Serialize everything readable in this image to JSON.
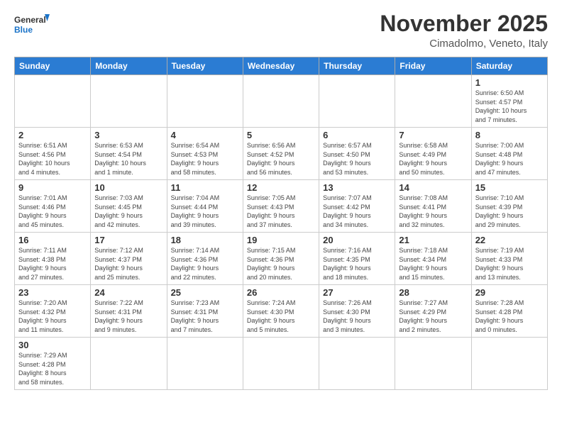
{
  "header": {
    "logo_general": "General",
    "logo_blue": "Blue",
    "title": "November 2025",
    "subtitle": "Cimadolmo, Veneto, Italy"
  },
  "weekdays": [
    "Sunday",
    "Monday",
    "Tuesday",
    "Wednesday",
    "Thursday",
    "Friday",
    "Saturday"
  ],
  "weeks": [
    [
      {
        "day": "",
        "info": ""
      },
      {
        "day": "",
        "info": ""
      },
      {
        "day": "",
        "info": ""
      },
      {
        "day": "",
        "info": ""
      },
      {
        "day": "",
        "info": ""
      },
      {
        "day": "",
        "info": ""
      },
      {
        "day": "1",
        "info": "Sunrise: 6:50 AM\nSunset: 4:57 PM\nDaylight: 10 hours\nand 7 minutes."
      }
    ],
    [
      {
        "day": "2",
        "info": "Sunrise: 6:51 AM\nSunset: 4:56 PM\nDaylight: 10 hours\nand 4 minutes."
      },
      {
        "day": "3",
        "info": "Sunrise: 6:53 AM\nSunset: 4:54 PM\nDaylight: 10 hours\nand 1 minute."
      },
      {
        "day": "4",
        "info": "Sunrise: 6:54 AM\nSunset: 4:53 PM\nDaylight: 9 hours\nand 58 minutes."
      },
      {
        "day": "5",
        "info": "Sunrise: 6:56 AM\nSunset: 4:52 PM\nDaylight: 9 hours\nand 56 minutes."
      },
      {
        "day": "6",
        "info": "Sunrise: 6:57 AM\nSunset: 4:50 PM\nDaylight: 9 hours\nand 53 minutes."
      },
      {
        "day": "7",
        "info": "Sunrise: 6:58 AM\nSunset: 4:49 PM\nDaylight: 9 hours\nand 50 minutes."
      },
      {
        "day": "8",
        "info": "Sunrise: 7:00 AM\nSunset: 4:48 PM\nDaylight: 9 hours\nand 47 minutes."
      }
    ],
    [
      {
        "day": "9",
        "info": "Sunrise: 7:01 AM\nSunset: 4:46 PM\nDaylight: 9 hours\nand 45 minutes."
      },
      {
        "day": "10",
        "info": "Sunrise: 7:03 AM\nSunset: 4:45 PM\nDaylight: 9 hours\nand 42 minutes."
      },
      {
        "day": "11",
        "info": "Sunrise: 7:04 AM\nSunset: 4:44 PM\nDaylight: 9 hours\nand 39 minutes."
      },
      {
        "day": "12",
        "info": "Sunrise: 7:05 AM\nSunset: 4:43 PM\nDaylight: 9 hours\nand 37 minutes."
      },
      {
        "day": "13",
        "info": "Sunrise: 7:07 AM\nSunset: 4:42 PM\nDaylight: 9 hours\nand 34 minutes."
      },
      {
        "day": "14",
        "info": "Sunrise: 7:08 AM\nSunset: 4:41 PM\nDaylight: 9 hours\nand 32 minutes."
      },
      {
        "day": "15",
        "info": "Sunrise: 7:10 AM\nSunset: 4:39 PM\nDaylight: 9 hours\nand 29 minutes."
      }
    ],
    [
      {
        "day": "16",
        "info": "Sunrise: 7:11 AM\nSunset: 4:38 PM\nDaylight: 9 hours\nand 27 minutes."
      },
      {
        "day": "17",
        "info": "Sunrise: 7:12 AM\nSunset: 4:37 PM\nDaylight: 9 hours\nand 25 minutes."
      },
      {
        "day": "18",
        "info": "Sunrise: 7:14 AM\nSunset: 4:36 PM\nDaylight: 9 hours\nand 22 minutes."
      },
      {
        "day": "19",
        "info": "Sunrise: 7:15 AM\nSunset: 4:36 PM\nDaylight: 9 hours\nand 20 minutes."
      },
      {
        "day": "20",
        "info": "Sunrise: 7:16 AM\nSunset: 4:35 PM\nDaylight: 9 hours\nand 18 minutes."
      },
      {
        "day": "21",
        "info": "Sunrise: 7:18 AM\nSunset: 4:34 PM\nDaylight: 9 hours\nand 15 minutes."
      },
      {
        "day": "22",
        "info": "Sunrise: 7:19 AM\nSunset: 4:33 PM\nDaylight: 9 hours\nand 13 minutes."
      }
    ],
    [
      {
        "day": "23",
        "info": "Sunrise: 7:20 AM\nSunset: 4:32 PM\nDaylight: 9 hours\nand 11 minutes."
      },
      {
        "day": "24",
        "info": "Sunrise: 7:22 AM\nSunset: 4:31 PM\nDaylight: 9 hours\nand 9 minutes."
      },
      {
        "day": "25",
        "info": "Sunrise: 7:23 AM\nSunset: 4:31 PM\nDaylight: 9 hours\nand 7 minutes."
      },
      {
        "day": "26",
        "info": "Sunrise: 7:24 AM\nSunset: 4:30 PM\nDaylight: 9 hours\nand 5 minutes."
      },
      {
        "day": "27",
        "info": "Sunrise: 7:26 AM\nSunset: 4:30 PM\nDaylight: 9 hours\nand 3 minutes."
      },
      {
        "day": "28",
        "info": "Sunrise: 7:27 AM\nSunset: 4:29 PM\nDaylight: 9 hours\nand 2 minutes."
      },
      {
        "day": "29",
        "info": "Sunrise: 7:28 AM\nSunset: 4:28 PM\nDaylight: 9 hours\nand 0 minutes."
      }
    ],
    [
      {
        "day": "30",
        "info": "Sunrise: 7:29 AM\nSunset: 4:28 PM\nDaylight: 8 hours\nand 58 minutes."
      },
      {
        "day": "",
        "info": ""
      },
      {
        "day": "",
        "info": ""
      },
      {
        "day": "",
        "info": ""
      },
      {
        "day": "",
        "info": ""
      },
      {
        "day": "",
        "info": ""
      },
      {
        "day": "",
        "info": ""
      }
    ]
  ]
}
